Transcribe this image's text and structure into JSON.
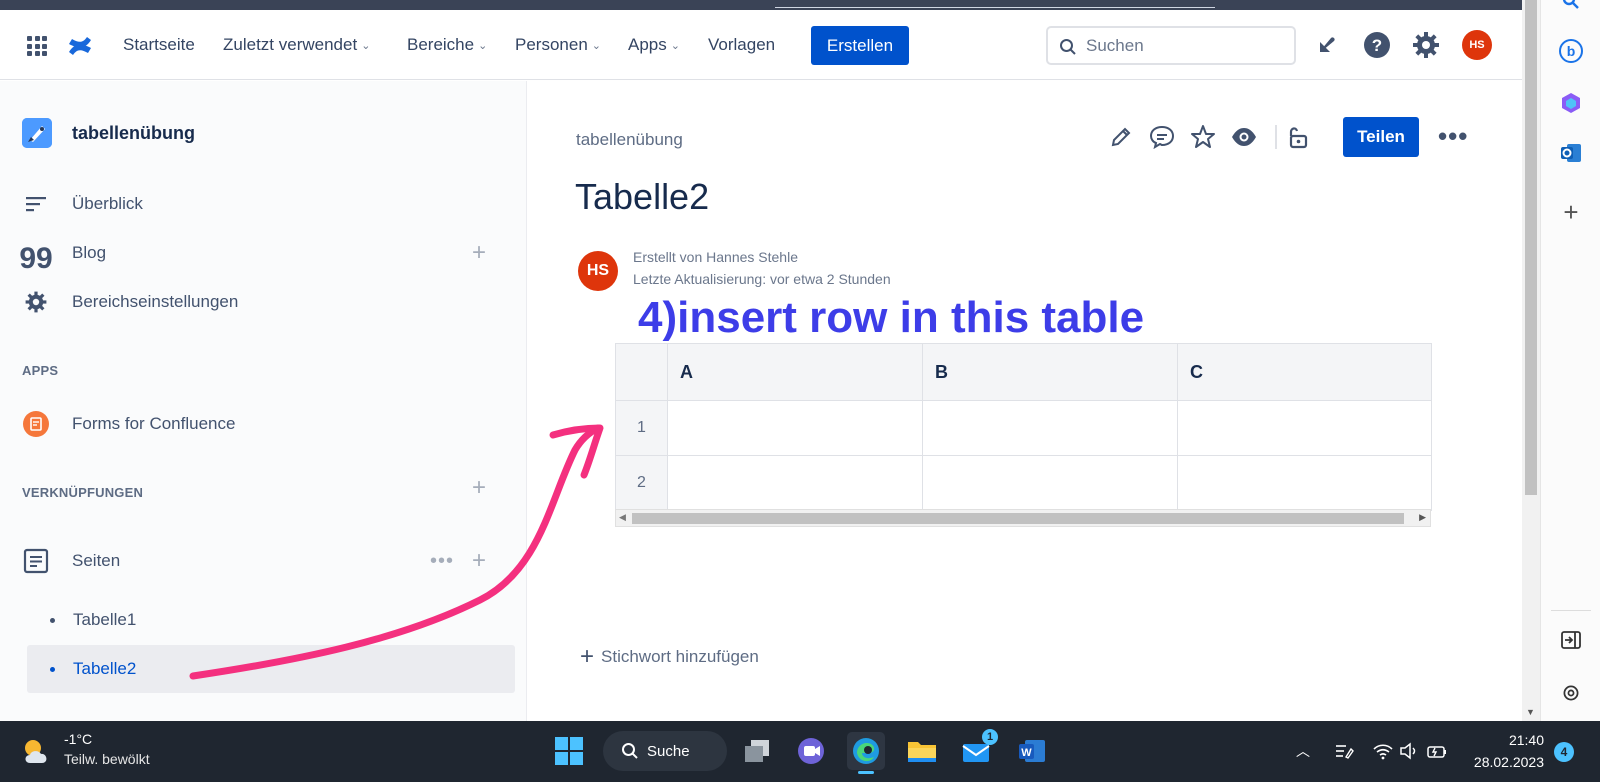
{
  "header": {
    "nav": [
      {
        "label": "Startseite",
        "dropdown": false
      },
      {
        "label": "Zuletzt verwendet",
        "dropdown": true
      },
      {
        "label": "Bereiche",
        "dropdown": true
      },
      {
        "label": "Personen",
        "dropdown": true
      },
      {
        "label": "Apps",
        "dropdown": true
      },
      {
        "label": "Vorlagen",
        "dropdown": false
      }
    ],
    "create_label": "Erstellen",
    "search_placeholder": "Suchen",
    "avatar_initials": "HS",
    "icons": [
      "app-switcher-icon",
      "confluence-logo",
      "search-icon",
      "notifications-icon",
      "help-icon",
      "settings-icon"
    ]
  },
  "sidebar": {
    "space_name": "tabellenübung",
    "items": [
      {
        "label": "Überblick",
        "icon": "overview-icon"
      },
      {
        "label": "Blog",
        "icon": "quote-icon"
      },
      {
        "label": "Bereichseinstellungen",
        "icon": "gear-icon"
      }
    ],
    "apps_heading": "APPS",
    "apps": [
      {
        "label": "Forms for Confluence",
        "icon": "forms-icon"
      }
    ],
    "shortcuts_heading": "VERKNÜPFUNGEN",
    "pages_label": "Seiten",
    "pages": [
      {
        "label": "Tabelle1",
        "active": false
      },
      {
        "label": "Tabelle2",
        "active": true
      }
    ]
  },
  "page": {
    "breadcrumb": "tabellenübung",
    "title": "Tabelle2",
    "author_initials": "HS",
    "created_by": "Erstellt von Hannes Stehle",
    "last_updated": "Letzte Aktualisierung: vor etwa 2 Stunden",
    "annotation": "4)insert row in this table",
    "annotation_color": "#3d3de8",
    "share_label": "Teilen",
    "actions": [
      "edit-icon",
      "comment-icon",
      "star-icon",
      "watch-icon",
      "restrictions-icon"
    ],
    "table": {
      "columns": [
        "A",
        "B",
        "C"
      ],
      "rows": [
        {
          "num": "1",
          "cells": [
            "",
            "",
            ""
          ]
        },
        {
          "num": "2",
          "cells": [
            "",
            "",
            ""
          ]
        }
      ]
    },
    "add_label_text": "Stichwort hinzufügen"
  },
  "colors": {
    "accent": "#0052cc",
    "avatar": "#de350b",
    "arrow": "#f4307f"
  },
  "taskbar": {
    "weather_temp": "-1°C",
    "weather_desc": "Teilw. bewölkt",
    "search_label": "Suche",
    "mail_badge": "1",
    "time": "21:40",
    "date": "28.02.2023",
    "notification_count": "4"
  }
}
